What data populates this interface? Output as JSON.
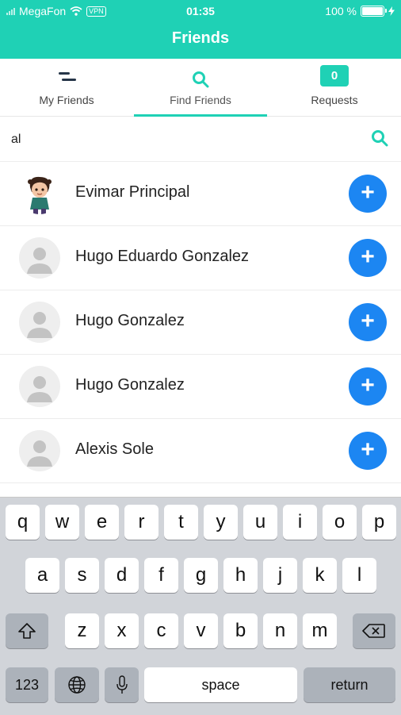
{
  "status": {
    "carrier": "MegaFon",
    "vpn": "VPN",
    "time": "01:35",
    "battery": "100 %"
  },
  "header": {
    "title": "Friends"
  },
  "tabs": [
    {
      "label": "My Friends",
      "icon": "menu-lines-icon"
    },
    {
      "label": "Find Friends",
      "icon": "search-icon"
    },
    {
      "label": "Requests",
      "badge": "0"
    }
  ],
  "search": {
    "value": "al"
  },
  "results": [
    {
      "name": "Evimar Principal",
      "avatar": "photo"
    },
    {
      "name": "Hugo Eduardo Gonzalez",
      "avatar": "placeholder"
    },
    {
      "name": "Hugo Gonzalez",
      "avatar": "placeholder"
    },
    {
      "name": "Hugo Gonzalez",
      "avatar": "placeholder"
    },
    {
      "name": "Alexis Sole",
      "avatar": "placeholder"
    }
  ],
  "add_symbol": "+",
  "keyboard": {
    "row1": [
      "q",
      "w",
      "e",
      "r",
      "t",
      "y",
      "u",
      "i",
      "o",
      "p"
    ],
    "row2": [
      "a",
      "s",
      "d",
      "f",
      "g",
      "h",
      "j",
      "k",
      "l"
    ],
    "row3": [
      "z",
      "x",
      "c",
      "v",
      "b",
      "n",
      "m"
    ],
    "numbers": "123",
    "space": "space",
    "return": "return"
  },
  "colors": {
    "accent": "#1fd1b5",
    "add_button": "#1c86f2"
  }
}
